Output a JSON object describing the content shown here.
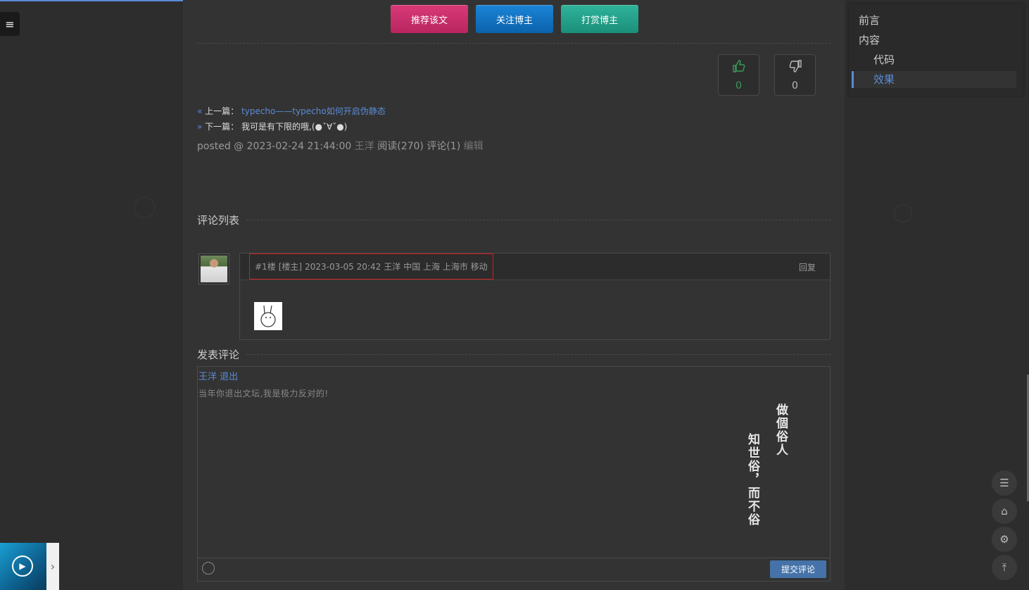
{
  "reward": {
    "recommend": "推荐该文",
    "follow": "关注博主",
    "tip": "打赏博主"
  },
  "vote": {
    "up_count": "0",
    "down_count": "0"
  },
  "post_nav": {
    "prev_arrow": "«",
    "prev_label": "上一篇：",
    "prev_title": "typecho——typecho如何开启伪静态",
    "next_arrow": "»",
    "next_label": "下一篇：",
    "next_title": "我可是有下限的哦,(●ˇ∀ˇ●)"
  },
  "posted": {
    "prefix": "posted @ 2023-02-24 21:44:00",
    "author": "王洋",
    "stats": "阅读(270) 评论(1)",
    "edit": "编辑"
  },
  "comments": {
    "title": "评论列表",
    "items": [
      {
        "floor": "#1楼",
        "tag": "[楼主]",
        "datetime": "2023-03-05 20:42",
        "author": "王洋",
        "location": "中国 上海 上海市 移动",
        "reply": "回复"
      }
    ]
  },
  "compose": {
    "title": "发表评论",
    "user": "王洋",
    "logout": "退出",
    "placeholder": "当年你退出文坛,我是极力反对的!",
    "quote_line1": "做個俗人",
    "quote_line2": "知世俗，而不俗",
    "submit": "提交评论"
  },
  "toc": {
    "items": [
      "前言",
      "内容",
      "代码",
      "效果"
    ],
    "active": "效果"
  },
  "colors": {
    "accent": "#5a8bd6",
    "recommend": "#c8306a",
    "follow": "#0e6fc0",
    "tip": "#22a08a"
  }
}
